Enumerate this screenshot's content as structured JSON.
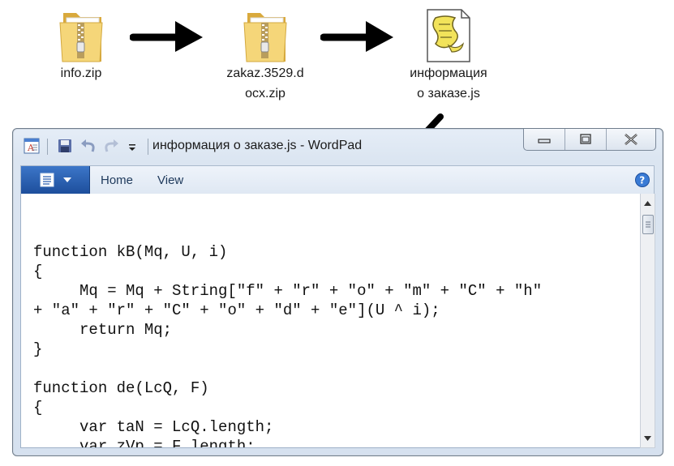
{
  "files": [
    {
      "name": "info.zip",
      "icon": "zip-folder-icon"
    },
    {
      "name": "zakaz.3529.d\nocx.zip",
      "icon": "zip-folder-icon"
    },
    {
      "name": "информация\nо заказе.js",
      "icon": "js-script-icon"
    }
  ],
  "window": {
    "title": "информация о заказе.js - WordPad",
    "tabs": [
      {
        "label": "Home"
      },
      {
        "label": "View"
      }
    ]
  },
  "document": {
    "code": "function kB(Mq, U, i)\n{\n     Mq = Mq + String[\"f\" + \"r\" + \"o\" + \"m\" + \"C\" + \"h\"\n+ \"a\" + \"r\" + \"C\" + \"o\" + \"d\" + \"e\"](U ^ i);\n     return Mq;\n}\n\nfunction de(LcQ, F)\n{\n     var taN = LcQ.length;\n     var zVp = F.length;"
  },
  "colors": {
    "ribbon_app_button": "#2a5fb0",
    "window_frame": "#dbe5f1",
    "arrow": "#000000"
  }
}
